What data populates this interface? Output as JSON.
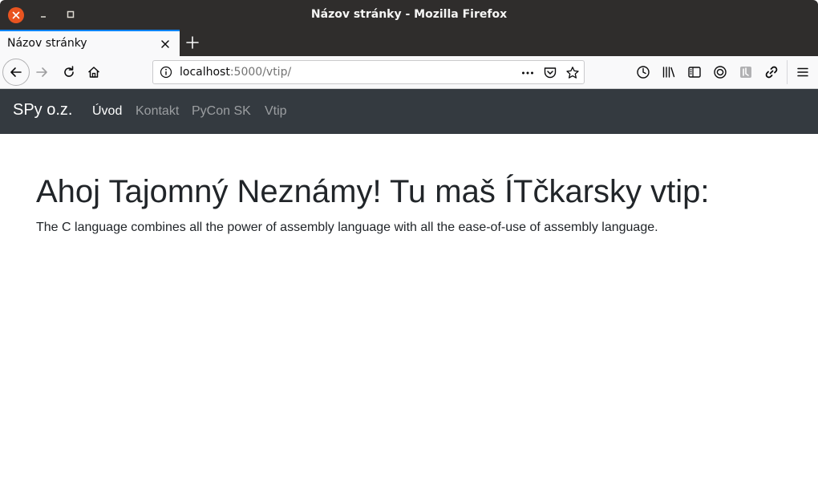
{
  "window": {
    "title": "Názov stránky - Mozilla Firefox"
  },
  "tabs": [
    {
      "label": "Názov stránky"
    }
  ],
  "urlbar": {
    "host": "localhost",
    "path": ":5000/vtip/"
  },
  "site": {
    "brand": "SPy o.z.",
    "nav": [
      {
        "label": "Úvod",
        "active": true
      },
      {
        "label": "Kontakt",
        "active": false
      },
      {
        "label": "PyCon SK",
        "active": false
      },
      {
        "label": "Vtip",
        "active": false
      }
    ],
    "heading": "Ahoj Tajomný Neznámy! Tu maš ÍTčkarsky vtip:",
    "joke": "The C language combines all the power of assembly language with all the ease-of-use of assembly language."
  },
  "colors": {
    "site_nav_bg": "#343a40",
    "close_button": "#e95420",
    "tab_accent": "#0a84ff"
  }
}
